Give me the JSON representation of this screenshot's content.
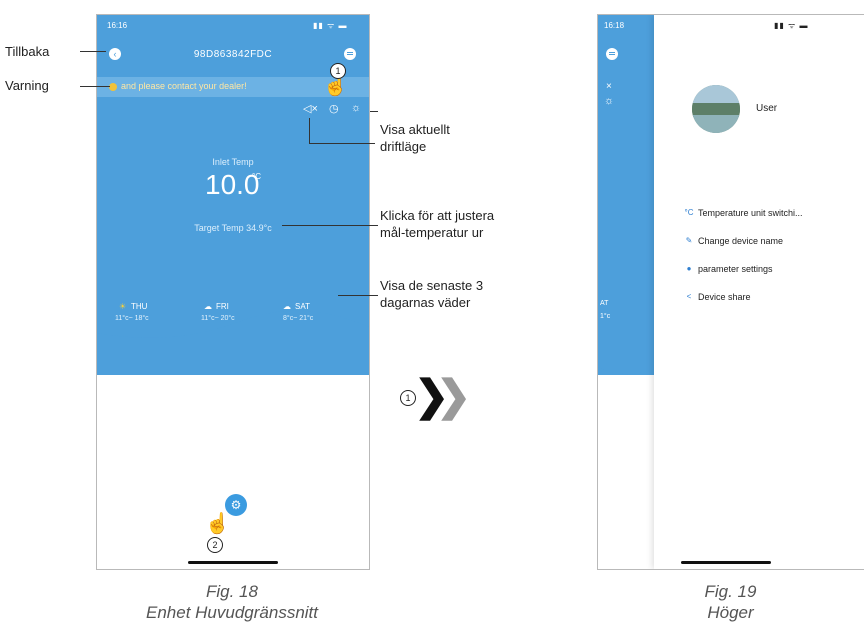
{
  "fig18": {
    "status_time": "16:16",
    "status_icons": "▮▮ ᯤ ▬",
    "device_id": "98D863842FDC",
    "warning_text": "and please contact your dealer!",
    "inlet_label": "Inlet Temp",
    "inlet_value": "10.0",
    "inlet_unit": "°C",
    "target_text": "Target Temp  34.9°c",
    "days": [
      {
        "name": "THU",
        "range": "11°c~ 18°c",
        "icon": "sun-icon"
      },
      {
        "name": "FRI",
        "range": "11°c~ 20°c",
        "icon": "cloud-sun-icon"
      },
      {
        "name": "SAT",
        "range": "8°c~ 21°c",
        "icon": "cloud-sun-icon"
      }
    ],
    "badge1": "1",
    "badge2": "2",
    "caption_fig": "Fig. 18",
    "caption_title": "Enhet Huvudgränssnitt"
  },
  "annotations": {
    "back": "Tillbaka",
    "warning": "Varning",
    "mode_line1": "Visa aktuellt",
    "mode_line2": "driftläge",
    "target_line1": "Klicka för att justera",
    "target_line2": "mål-temperatur ur",
    "weather_line1": "Visa de senaste 3",
    "weather_line2": "dagarnas väder"
  },
  "arrow_label": "1",
  "fig19": {
    "status_time": "16:18",
    "status_icons": "▮▮ ᯤ ▬",
    "user_name": "User",
    "menu_items": [
      {
        "label": "Temperature unit switchi...",
        "icon": "°C"
      },
      {
        "label": "Change device name",
        "icon": "✎"
      },
      {
        "label": "parameter settings",
        "icon": "●"
      },
      {
        "label": "Device share",
        "icon": "<"
      }
    ],
    "side_labels": {
      "close": "×",
      "day": "AT",
      "temp": "1°c"
    },
    "caption_fig": "Fig. 19",
    "caption_title": "Höger"
  },
  "colors": {
    "accent": "#4d9fdb",
    "warning": "#f0c23a"
  }
}
